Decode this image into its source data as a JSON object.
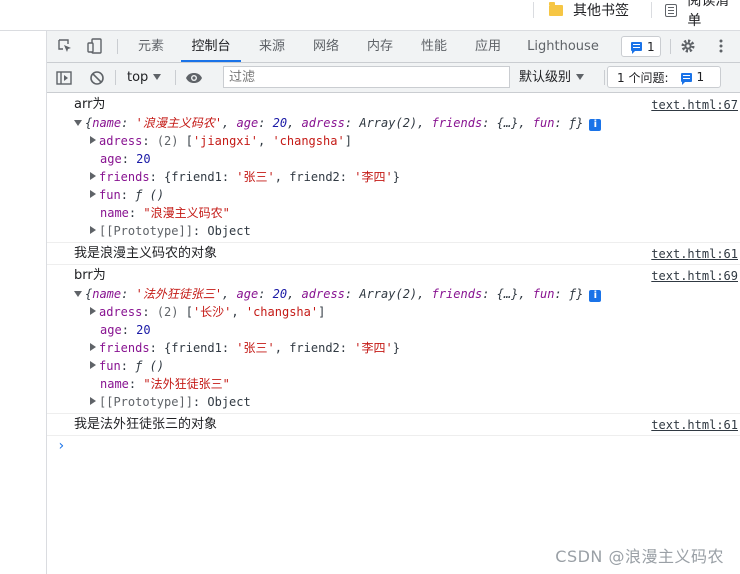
{
  "bookmarks": [
    {
      "label": "其他书签",
      "icon": "folder-icon"
    },
    {
      "label": "阅读清单",
      "icon": "reading-list-icon"
    }
  ],
  "devtools": {
    "tabs": [
      "元素",
      "控制台",
      "来源",
      "网络",
      "内存",
      "性能",
      "应用",
      "Lighthouse"
    ],
    "active_tab": "控制台",
    "message_count": "1",
    "toolbar": {
      "context": "top",
      "filter_placeholder": "过滤",
      "level": "默认级别",
      "issues_label": "1 个问题:",
      "issues_count": "1"
    }
  },
  "console": {
    "arr": {
      "label": "arr为",
      "source": "text.html:67",
      "summary": {
        "name_key": "name",
        "name_val": "'浪漫主义码农'",
        "age_key": "age",
        "age_val": "20",
        "adress_key": "adress",
        "adress_val": "Array(2)",
        "friends_key": "friends",
        "friends_val": "{…}",
        "fun_key": "fun",
        "fun_val": "ƒ"
      },
      "adress": {
        "key": "adress",
        "len": "(2)",
        "v1": "'jiangxi'",
        "v2": "'changsha'"
      },
      "age": {
        "key": "age",
        "val": "20"
      },
      "friends": {
        "key": "friends",
        "k1": "friend1",
        "v1": "'张三'",
        "k2": "friend2",
        "v2": "'李四'"
      },
      "fun": {
        "key": "fun",
        "val": "ƒ ()"
      },
      "name": {
        "key": "name",
        "val": "\"浪漫主义码农\""
      },
      "proto": {
        "key": "[[Prototype]]",
        "val": "Object"
      }
    },
    "log1": {
      "text": "我是浪漫主义码农的对象",
      "source": "text.html:61"
    },
    "brr": {
      "label": "brr为",
      "source": "text.html:69",
      "summary": {
        "name_key": "name",
        "name_val": "'法外狂徒张三'",
        "age_key": "age",
        "age_val": "20",
        "adress_key": "adress",
        "adress_val": "Array(2)",
        "friends_key": "friends",
        "friends_val": "{…}",
        "fun_key": "fun",
        "fun_val": "ƒ"
      },
      "adress": {
        "key": "adress",
        "len": "(2)",
        "v1": "'长沙'",
        "v2": "'changsha'"
      },
      "age": {
        "key": "age",
        "val": "20"
      },
      "friends": {
        "key": "friends",
        "k1": "friend1",
        "v1": "'张三'",
        "k2": "friend2",
        "v2": "'李四'"
      },
      "fun": {
        "key": "fun",
        "val": "ƒ ()"
      },
      "name": {
        "key": "name",
        "val": "\"法外狂徒张三\""
      },
      "proto": {
        "key": "[[Prototype]]",
        "val": "Object"
      }
    },
    "log2": {
      "text": "我是法外狂徒张三的对象",
      "source": "text.html:61"
    },
    "prompt": "›",
    "info_badge": "i"
  },
  "watermark": "CSDN @浪漫主义码农",
  "colors": {
    "accent": "#1a73e8",
    "key": "#881391",
    "string": "#c41a16",
    "number": "#1a1aa6"
  }
}
